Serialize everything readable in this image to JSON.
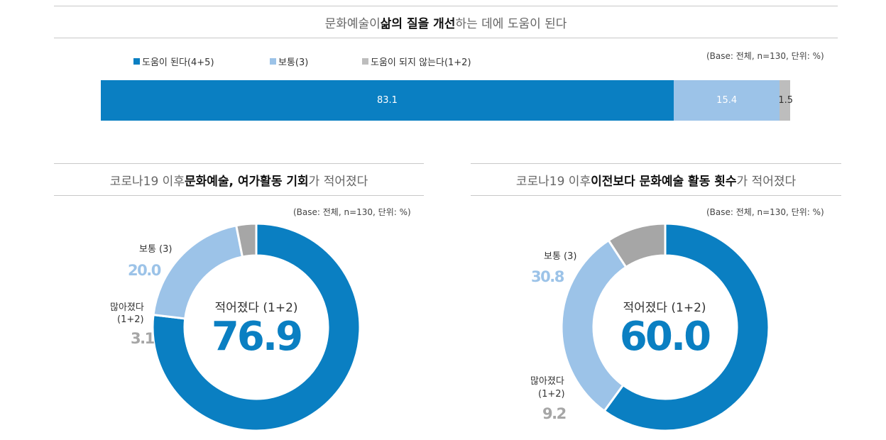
{
  "top": {
    "title_pre": "문화예술이 ",
    "title_bold": "삶의 질을 개선",
    "title_post": "하는 데에 도움이 된다",
    "base": "(Base: 전체, n=130, 단위: %)",
    "legend": [
      "도움이 된다(4+5)",
      "보통(3)",
      "도움이 되지 않는다(1+2)"
    ]
  },
  "left": {
    "title_pre": "코로나19 이후 ",
    "title_bold": "문화예술, 여가활동 기회",
    "title_post": "가 적어졌다",
    "base": "(Base: 전체, n=130, 단위: %)",
    "center_label": "적어졌다 (1+2)",
    "center_value": "76.9",
    "normal_label": "보통 (3)",
    "normal_value": "20.0",
    "more_label_1": "많아졌다",
    "more_label_2": "(1+2)",
    "more_value": "3.1"
  },
  "right": {
    "title_pre": "코로나19 이후 ",
    "title_bold": "이전보다 문화예술 활동 횟수",
    "title_post": "가 적어졌다",
    "base": "(Base: 전체, n=130, 단위: %)",
    "center_label": "적어졌다 (1+2)",
    "center_value": "60.0",
    "normal_label": "보통 (3)",
    "normal_value": "30.8",
    "more_label_1": "많아졌다",
    "more_label_2": "(1+2)",
    "more_value": "9.2"
  },
  "colors": {
    "dark": "#0a7fc2",
    "light": "#9cc3e8",
    "gray": "#a6a6a6"
  },
  "chart_data": [
    {
      "type": "bar",
      "stacked": true,
      "orientation": "horizontal",
      "categories": [
        "도움이 된다(4+5)",
        "보통(3)",
        "도움이 되지 않는다(1+2)"
      ],
      "values": [
        83.1,
        15.4,
        1.5
      ],
      "labels": [
        "83.1",
        "15.4",
        "1.5"
      ]
    },
    {
      "type": "pie",
      "donut": true,
      "categories": [
        "적어졌다 (1+2)",
        "보통 (3)",
        "많아졌다 (1+2)"
      ],
      "values": [
        76.9,
        20.0,
        3.1
      ]
    },
    {
      "type": "pie",
      "donut": true,
      "categories": [
        "적어졌다 (1+2)",
        "보통 (3)",
        "많아졌다 (1+2)"
      ],
      "values": [
        60.0,
        30.8,
        9.2
      ]
    }
  ]
}
